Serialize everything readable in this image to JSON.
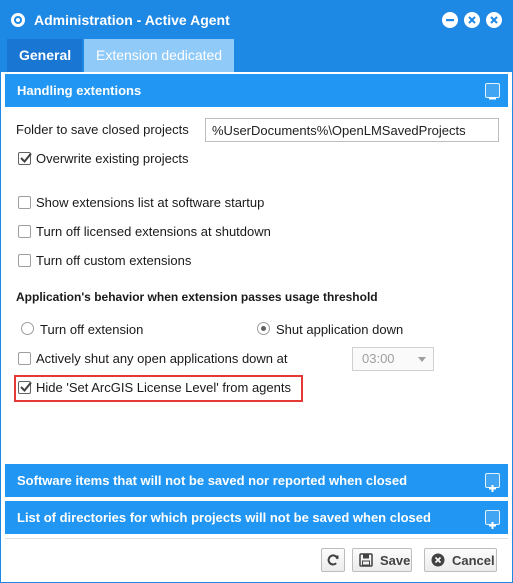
{
  "window": {
    "title": "Administration - Active Agent",
    "logo_icon": "agent-logo-icon",
    "controls": [
      "minimize-icon",
      "restore-icon",
      "close-icon"
    ],
    "accent_color": "#1e88e5"
  },
  "tabs": [
    {
      "label": "General",
      "active": true
    },
    {
      "label": "Extension dedicated",
      "active": false
    }
  ],
  "handling": {
    "header": "Handling extentions",
    "folder_label": "Folder to save closed projects",
    "folder_value": "%UserDocuments%\\OpenLMSavedProjects",
    "options": [
      {
        "label": "Overwrite existing projects",
        "checked": true
      },
      {
        "label": "Show extensions list at software startup",
        "checked": false
      },
      {
        "label": "Turn off licensed extensions at shutdown",
        "checked": false
      },
      {
        "label": "Turn off custom extensions",
        "checked": false
      }
    ],
    "threshold_heading": "Application's behavior when extension passes usage threshold",
    "threshold_options": [
      {
        "label": "Turn off extension",
        "selected": false
      },
      {
        "label": "Shut application down",
        "selected": true
      }
    ],
    "shutdown_label": "Actively shut any open applications down at",
    "shutdown_checked": false,
    "shutdown_time": "03:00",
    "hide_label": "Hide 'Set ArcGIS License Level' from agents",
    "hide_checked": true
  },
  "sections": {
    "software_items": "Software items that will not be saved nor reported when closed",
    "directories": "List of directories for which projects will not be saved when closed"
  },
  "footer": {
    "refresh_icon": "refresh-icon",
    "save_label": "Save",
    "cancel_label": "Cancel"
  }
}
